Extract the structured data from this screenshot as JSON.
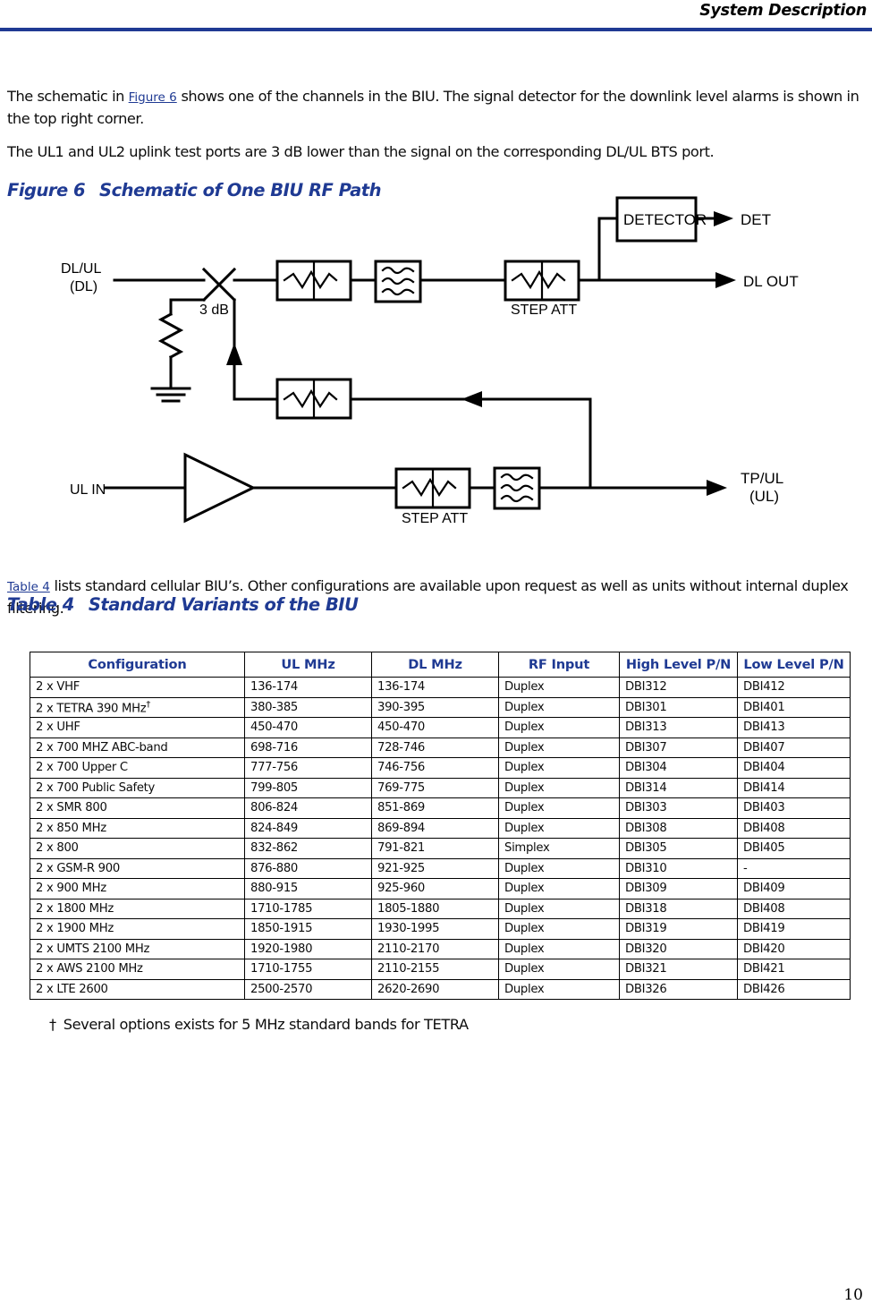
{
  "header": {
    "title": "System Description"
  },
  "body": {
    "para1_before": "The schematic in ",
    "para1_xref": "Figure 6",
    "para1_after": " shows one of the channels in the BIU. The signal detector for the downlink level alarms is shown in the top right corner.",
    "para2": "The UL1 and UL2 uplink test ports are 3 dB lower than the signal on the corresponding DL/UL BTS port.",
    "para3_xref": "Table 4",
    "para3_after": " lists standard cellular BIU’s. Other configurations are available upon request as well as units without internal duplex filtering."
  },
  "figure": {
    "number": "Figure 6",
    "title": "Schematic of One BIU RF Path",
    "labels": {
      "dl_ul_port": "DL/UL",
      "dl_ul_port_sub": "(DL)",
      "coupler": "3 dB",
      "detector_box": "DETECTOR",
      "det_out": "DET",
      "dl_out": "DL OUT",
      "step_att_top": "STEP ATT",
      "step_att_bottom": "STEP ATT",
      "ul_in": "UL IN",
      "tp_ul": "TP/UL",
      "tp_ul_sub": "(UL)"
    }
  },
  "table": {
    "number": "Table 4",
    "title": "Standard Variants of the BIU",
    "columns": [
      "Configuration",
      "UL MHz",
      "DL MHz",
      "RF Input",
      "High Level P/N",
      "Low Level P/N"
    ],
    "rows": [
      [
        "2 x VHF",
        "136-174",
        "136-174",
        "Duplex",
        "DBI312",
        "DBI412"
      ],
      [
        "2 x TETRA 390 MHz",
        "380-385",
        "390-395",
        "Duplex",
        "DBI301",
        "DBI401"
      ],
      [
        "2 x UHF",
        "450-470",
        "450-470",
        "Duplex",
        "DBI313",
        "DBI413"
      ],
      [
        "2 x 700 MHZ ABC-band",
        "698-716",
        "728-746",
        "Duplex",
        "DBI307",
        "DBI407"
      ],
      [
        "2 x 700 Upper C",
        "777-756",
        "746-756",
        "Duplex",
        "DBI304",
        "DBI404"
      ],
      [
        "2 x 700 Public Safety",
        "799-805",
        "769-775",
        "Duplex",
        "DBI314",
        "DBI414"
      ],
      [
        "2 x SMR 800",
        "806-824",
        "851-869",
        "Duplex",
        "DBI303",
        "DBI403"
      ],
      [
        "2 x 850 MHz",
        "824-849",
        "869-894",
        "Duplex",
        "DBI308",
        "DBI408"
      ],
      [
        "2 x 800",
        "832-862",
        "791-821",
        "Simplex",
        "DBI305",
        "DBI405"
      ],
      [
        "2 x GSM-R 900",
        "876-880",
        "921-925",
        "Duplex",
        "DBI310",
        "-"
      ],
      [
        "2 x 900 MHz",
        "880-915",
        "925-960",
        "Duplex",
        "DBI309",
        "DBI409"
      ],
      [
        "2 x 1800 MHz",
        "1710-1785",
        "1805-1880",
        "Duplex",
        "DBI318",
        "DBI408"
      ],
      [
        "2 x 1900 MHz",
        "1850-1915",
        "1930-1995",
        "Duplex",
        "DBI319",
        "DBI419"
      ],
      [
        "2 x UMTS 2100 MHz",
        "1920-1980",
        "2110-2170",
        "Duplex",
        "DBI320",
        "DBI420"
      ],
      [
        "2 x AWS 2100 MHz",
        "1710-1755",
        "2110-2155",
        "Duplex",
        "DBI321",
        "DBI421"
      ],
      [
        "2 x LTE 2600",
        "2500-2570",
        "2620-2690",
        "Duplex",
        "DBI326",
        "DBI426"
      ]
    ],
    "dagger_row_index": 1,
    "dagger_symbol": "†"
  },
  "footnote": {
    "mark": "†",
    "text": "Several options exists for 5 MHz standard bands for TETRA"
  },
  "footer": {
    "page_number": "10"
  },
  "colors": {
    "accent_blue": "#1f3a93",
    "text_black": "#0d0d0d"
  }
}
